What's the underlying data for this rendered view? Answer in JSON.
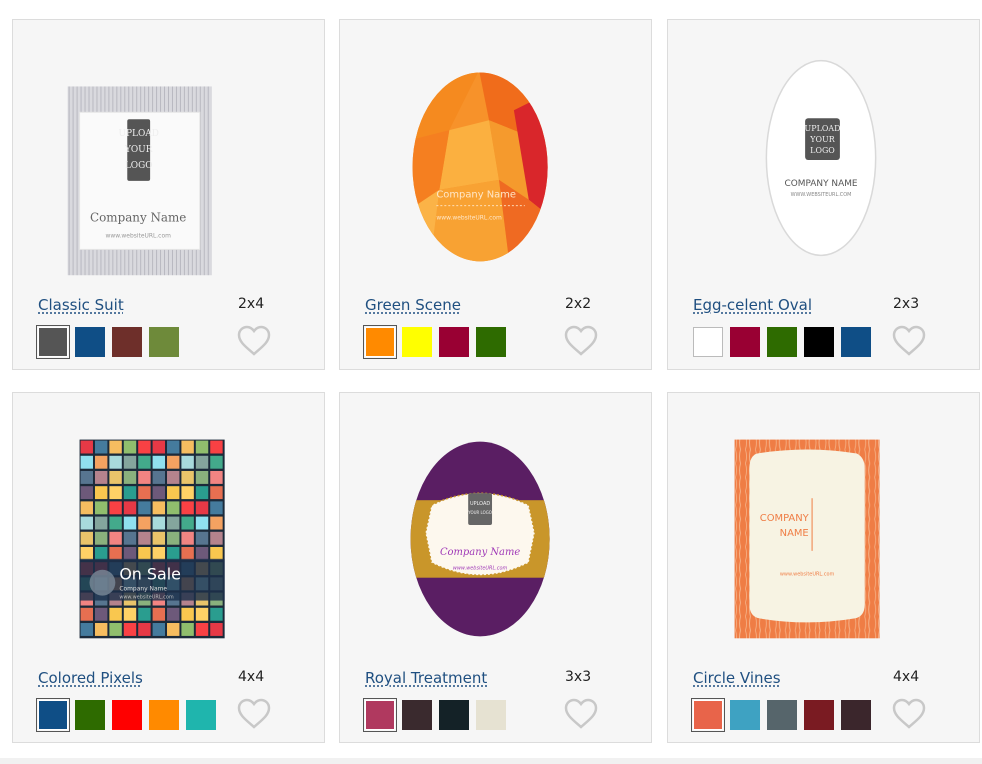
{
  "cards": [
    {
      "title": "Classic Suit",
      "size": "2x4",
      "swatches": [
        "#555555",
        "#0f4e86",
        "#6e2f2a",
        "#6e8a3a"
      ],
      "thumb": {
        "logo_lines": [
          "UPLOAD",
          "YOUR",
          "LOGO"
        ],
        "company": "Company Name",
        "url": "www.websiteURL.com"
      }
    },
    {
      "title": "Green Scene",
      "size": "2x2",
      "swatches": [
        "#ff8a00",
        "#ffff00",
        "#990033",
        "#2e6b00"
      ],
      "thumb": {
        "company": "Company Name",
        "url": "www.websiteURL.com"
      }
    },
    {
      "title": "Egg-celent Oval",
      "size": "2x3",
      "swatches": [
        "#ffffff",
        "#990033",
        "#2e6b00",
        "#000000",
        "#0f4e86"
      ],
      "thumb": {
        "logo_lines": [
          "UPLOAD",
          "YOUR",
          "LOGO"
        ],
        "company": "COMPANY NAME",
        "url": "WWW.WEBSITEURL.COM"
      }
    },
    {
      "title": "Colored Pixels",
      "size": "4x4",
      "swatches": [
        "#0f4e86",
        "#2e6b00",
        "#ff0000",
        "#ff8a00",
        "#1fb5ad"
      ],
      "thumb": {
        "headline": "On Sale",
        "company": "Company Name",
        "url": "www.websiteURL.com"
      }
    },
    {
      "title": "Royal Treatment",
      "size": "3x3",
      "swatches": [
        "#b0395f",
        "#3a2a2e",
        "#142227",
        "#e6e2d2"
      ],
      "thumb": {
        "logo_lines": [
          "UPLOAD",
          "YOUR LOGO"
        ],
        "company": "Company Name",
        "url": "www.websiteURL.com"
      }
    },
    {
      "title": "Circle Vines",
      "size": "4x4",
      "swatches": [
        "#e8644a",
        "#3ea2c2",
        "#56656b",
        "#7a1b22",
        "#3b262c"
      ],
      "thumb": {
        "company_lines": [
          "COMPANY",
          "NAME"
        ],
        "url": "www.websiteURL.com"
      }
    }
  ],
  "icons": {
    "favorite": "heart-outline-icon"
  }
}
